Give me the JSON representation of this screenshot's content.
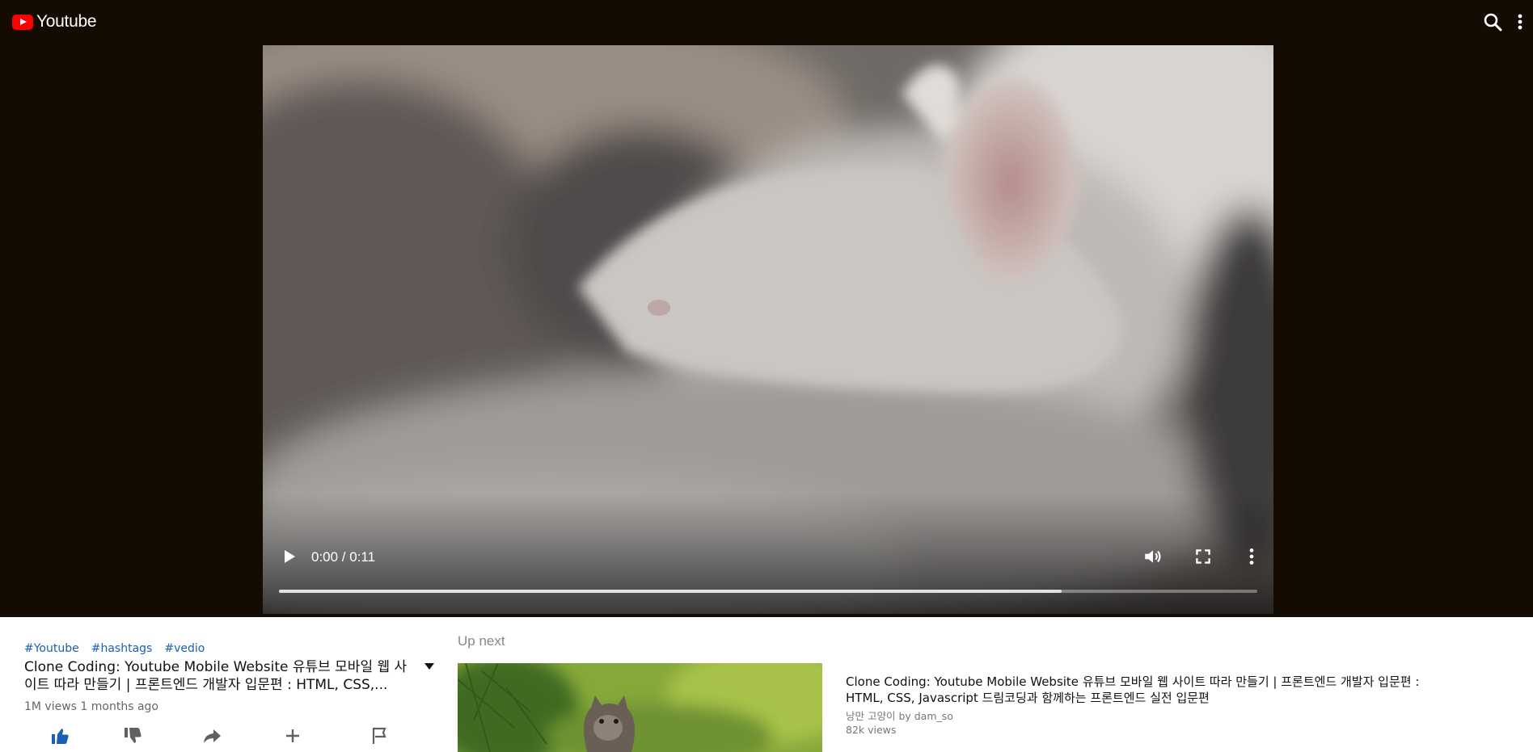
{
  "header": {
    "app_title": "Youtube",
    "icons": {
      "logo": "youtube-play-icon",
      "search": "search-icon",
      "more": "more-vert-icon"
    },
    "background": "#140b02"
  },
  "player": {
    "time_display": "0:00 / 0:11",
    "buffered_fraction": 0.8,
    "played_fraction": 0.0,
    "icons": {
      "play": "play-icon",
      "volume": "volume-icon",
      "fullscreen": "fullscreen-icon",
      "menu": "more-vert-icon"
    }
  },
  "video_info": {
    "hashtags": [
      "#Youtube",
      "#hashtags",
      "#vedio"
    ],
    "title": "Clone Coding: Youtube Mobile Website 유튜브 모바일 웹 사이트 따라 만들기 | 프론트엔드 개발자 입문편 : HTML, CSS,...",
    "meta": "1M views 1 months ago",
    "actions": [
      "thumb-up-icon",
      "thumb-down-icon",
      "share-icon",
      "add-icon",
      "flag-icon"
    ],
    "colors": {
      "hashtag": "#1a5fb4",
      "liked": "#1a5fb4"
    }
  },
  "up_next": {
    "heading": "Up next",
    "items": [
      {
        "title": "Clone Coding: Youtube Mobile Website 유튜브 모바일 웹 사이트 따라 만들기 | 프론트엔드 개발자 입문편 : HTML, CSS, Javascript 드림코딩과 함께하는 프론트엔드 실전 입문편",
        "channel": "낭만 고양이 by dam_so",
        "views": "82k views"
      }
    ]
  }
}
